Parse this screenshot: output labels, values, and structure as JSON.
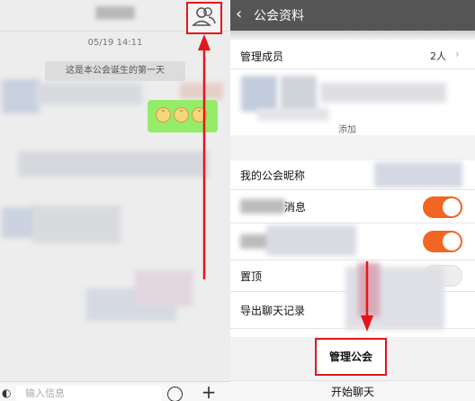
{
  "left": {
    "timestamp": "05/19 14:11",
    "system_message": "这是本公会诞生的第一天",
    "input_placeholder": "输入信息",
    "plus_label": "+",
    "emoji_faces": [
      "˘",
      "˘",
      "˘"
    ]
  },
  "right": {
    "nav_back": "‹",
    "nav_title": "公会资料",
    "members_label": "管理成员",
    "members_count": "2人",
    "chevron": "›",
    "add_label": "添加",
    "nickname_label": "我的公会昵称",
    "message_label": "消息",
    "pin_label": "置顶",
    "export_label": "导出聊天记录",
    "manage_label": "管理公会",
    "start_chat_label": "开始聊天",
    "toggle_1_on": true,
    "toggle_2_on": true
  },
  "colors": {
    "annotation_red": "#e4161c",
    "toggle_orange": "#f26522",
    "chat_green": "#95ec69"
  }
}
